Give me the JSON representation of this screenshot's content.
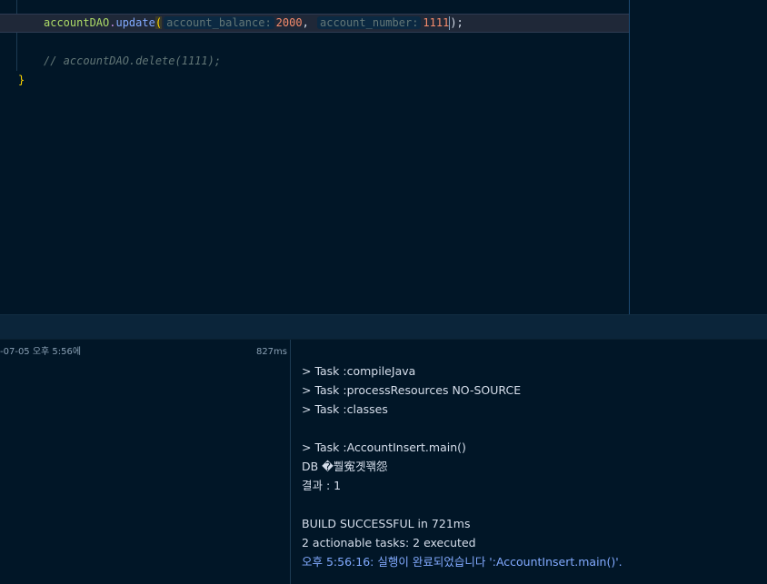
{
  "editor": {
    "current_line": {
      "object": "accountDAO",
      "dot": ".",
      "method": "update",
      "open_paren": "(",
      "hint_1": "account_balance:",
      "value_1": "2000",
      "comma": ",",
      "hint_2": "account_number:",
      "value_2": "1111",
      "close": ");"
    },
    "comment_line": "// accountDAO.delete(1111);",
    "closing_brace": "}"
  },
  "run_panel": {
    "tree_item": {
      "label": "-07-05 오후 5:56에",
      "duration": "827ms"
    },
    "console_lines": [
      "> Task :compileJava",
      "> Task :processResources NO-SOURCE",
      "> Task :classes",
      "",
      "> Task :AccountInsert.main()",
      "DB �뿰寃곗꽦怨",
      "결과 : 1",
      "",
      "BUILD SUCCESSFUL in 721ms",
      "2 actionable tasks: 2 executed",
      "오후 5:56:16: 실행이 완료되었습니다 ':AccountInsert.main()'."
    ]
  },
  "colors": {
    "background": "#011627",
    "status_text": "#82aaff",
    "number": "#f78c6c",
    "method": "#82aaff",
    "object": "#addb67"
  }
}
